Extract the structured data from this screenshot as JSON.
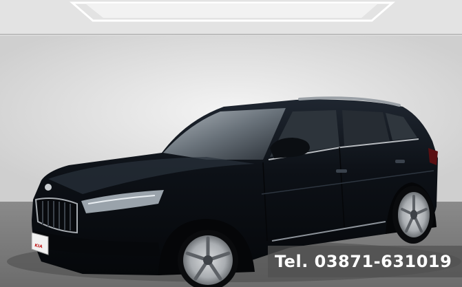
{
  "overlay": {
    "phone_text": "Tel. 03871-631019"
  },
  "plate": {
    "text": "KIA"
  },
  "colors": {
    "car_body": "#0e1218",
    "wall": "#e7e7e7",
    "floor": "#7d7d7d",
    "ceiling_light": "#f7f7f7",
    "overlay_bg": "#505050"
  }
}
